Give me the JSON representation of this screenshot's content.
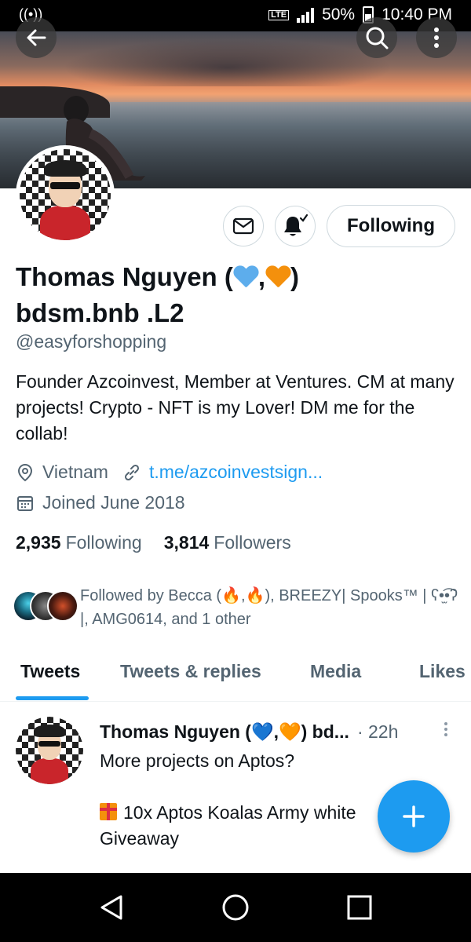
{
  "status_bar": {
    "network": "LTE",
    "battery": "50%",
    "time": "10:40 PM"
  },
  "profile": {
    "display_name_part1": "Thomas Nguyen (",
    "display_name_sep": ",",
    "display_name_part2": ")",
    "display_name_line2": "bdsm.bnb .L2",
    "handle": "@easyforshopping",
    "bio": "Founder Azcoinvest, Member at Ventures. CM at many projects! Crypto - NFT is my Lover! DM me for the collab!",
    "location": "Vietnam",
    "link": "t.me/azcoinvestsign...",
    "joined": "Joined June 2018",
    "following_count": "2,935",
    "following_label": "Following",
    "followers_count": "3,814",
    "followers_label": "Followers",
    "follow_button": "Following",
    "followed_by": "Followed by Becca (🔥,🔥), BREEZY| Spooks™ | ʕ•̫͡•ʔ |, AMG0614, and 1 other"
  },
  "tabs": [
    "Tweets",
    "Tweets & replies",
    "Media",
    "Likes"
  ],
  "tweet": {
    "author": "Thomas Nguyen (💙,🧡) bd...",
    "time": "· 22h",
    "line1": "More projects on Aptos?",
    "line2": "10x Aptos Koalas Army white",
    "line3": "Giveaway"
  },
  "colors": {
    "accent": "#1d9bf0",
    "heart_blue": "#5dadec",
    "heart_orange": "#f4900c"
  },
  "icons": [
    "back-arrow-icon",
    "search-icon",
    "more-vertical-icon",
    "mail-icon",
    "bell-check-icon",
    "location-pin-icon",
    "link-icon",
    "calendar-icon",
    "plus-icon",
    "nav-back-icon",
    "nav-home-icon",
    "nav-recents-icon"
  ]
}
